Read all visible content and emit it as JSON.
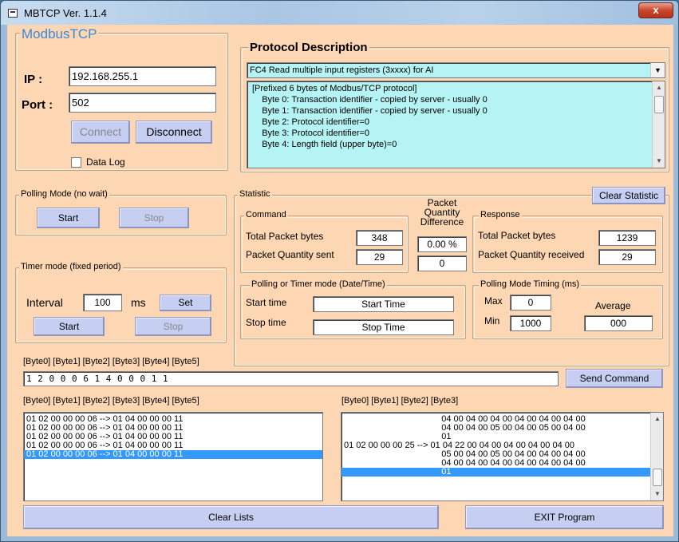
{
  "window": {
    "title": "MBTCP Ver. 1.1.4",
    "close_glyph": "x"
  },
  "modbus": {
    "legend": "ModbusTCP",
    "ip_label": "IP :",
    "ip_value": "192.168.255.1",
    "port_label": "Port :",
    "port_value": "502",
    "connect_label": "Connect",
    "disconnect_label": "Disconnect",
    "datalog_label": "Data Log"
  },
  "protocol": {
    "legend": "Protocol Description",
    "selected_function": "FC4  Read multiple input registers (3xxxx)  for AI",
    "description_lines": [
      "[Prefixed 6 bytes of Modbus/TCP protocol]",
      "    Byte 0: Transaction identifier - copied by server - usually 0",
      "    Byte 1: Transaction identifier - copied by server - usually 0",
      "    Byte 2: Protocol identifier=0",
      "    Byte 3: Protocol identifier=0",
      "    Byte 4: Length field (upper byte)=0"
    ]
  },
  "polling": {
    "legend": "Polling Mode (no wait)",
    "start_label": "Start",
    "stop_label": "Stop"
  },
  "timer": {
    "legend": "Timer mode (fixed period)",
    "interval_label": "Interval",
    "interval_value": "100",
    "unit": "ms",
    "set_label": "Set",
    "start_label": "Start",
    "stop_label": "Stop"
  },
  "statistic": {
    "legend": "Statistic",
    "clear_label": "Clear Statistic",
    "command": {
      "legend": "Command",
      "total_bytes_label": "Total Packet bytes",
      "total_bytes_value": "348",
      "qty_sent_label": "Packet Quantity sent",
      "qty_sent_value": "29"
    },
    "difference": {
      "label_line1": "Packet",
      "label_line2": "Quantity",
      "label_line3": "Difference",
      "percent_value": "0.00 %",
      "count_value": "0"
    },
    "response": {
      "legend": "Response",
      "total_bytes_label": "Total Packet bytes",
      "total_bytes_value": "1239",
      "qty_received_label": "Packet Quantity received",
      "qty_received_value": "29"
    },
    "datetime": {
      "legend": "Polling  or Timer mode  (Date/Time)",
      "start_label": "Start time",
      "start_value": "Start Time",
      "stop_label": "Stop time",
      "stop_value": "Stop Time"
    },
    "timing": {
      "legend": "Polling Mode Timing (ms)",
      "max_label": "Max",
      "max_value": "0",
      "min_label": "Min",
      "min_value": "1000",
      "avg_label": "Average",
      "avg_value": "000"
    }
  },
  "command_input": {
    "header": "[Byte0]  [Byte1]  [Byte2]  [Byte3]  [Byte4]  [Byte5]",
    "value": "1 2 0 0 0 6    1  4 0 0 0 1 1",
    "send_label": "Send Command"
  },
  "left_list": {
    "header": "[Byte0]  [Byte1]  [Byte2]  [Byte3]  [Byte4]  [Byte5]",
    "rows": [
      "01 02 00 00 00 06 --> 01 04 00 00 00 11",
      "01 02 00 00 00 06 --> 01 04 00 00 00 11",
      "01 02 00 00 00 06 --> 01 04 00 00 00 11",
      "01 02 00 00 00 06 --> 01 04 00 00 00 11",
      "01 02 00 00 00 06 --> 01 04 00 00 00 11"
    ],
    "selected_index": 4
  },
  "right_list": {
    "header": "[Byte0]  [Byte1]  [Byte2]  [Byte3]",
    "rows": [
      "                                        04 00 04 00 04 00 04 00 04 00 04 00",
      "                                        04 00 04 00 05 00 04 00 05 00 04 00",
      "                                        01",
      "01 02 00 00 00 25 --> 01 04 22 00 04 00 04 00 04 00 04 00",
      "                                        05 00 04 00 05 00 04 00 04 00 04 00",
      "                                        04 00 04 00 04 00 04 00 04 00 04 00",
      "                                        01"
    ],
    "selected_index": 6
  },
  "footer": {
    "clear_lists_label": "Clear Lists",
    "exit_label": "EXIT Program"
  }
}
